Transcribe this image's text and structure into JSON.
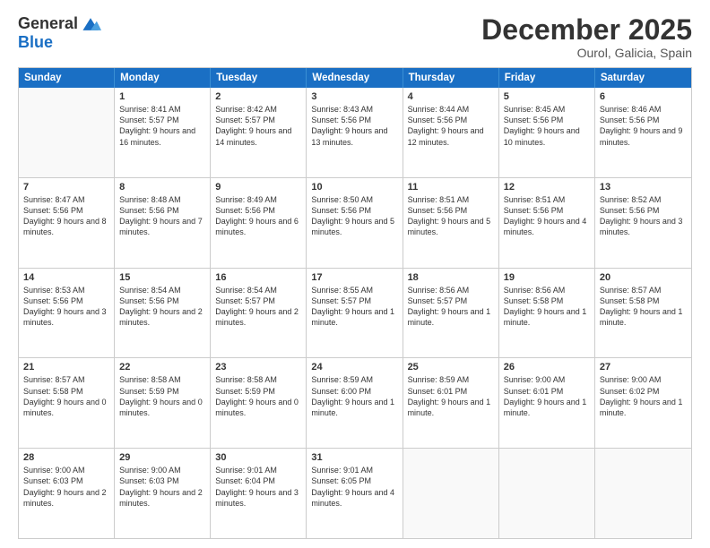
{
  "logo": {
    "general": "General",
    "blue": "Blue"
  },
  "header": {
    "month": "December 2025",
    "location": "Ourol, Galicia, Spain"
  },
  "weekdays": [
    "Sunday",
    "Monday",
    "Tuesday",
    "Wednesday",
    "Thursday",
    "Friday",
    "Saturday"
  ],
  "weeks": [
    [
      {
        "day": "",
        "empty": true
      },
      {
        "day": "1",
        "sunrise": "Sunrise: 8:41 AM",
        "sunset": "Sunset: 5:57 PM",
        "daylight": "Daylight: 9 hours and 16 minutes."
      },
      {
        "day": "2",
        "sunrise": "Sunrise: 8:42 AM",
        "sunset": "Sunset: 5:57 PM",
        "daylight": "Daylight: 9 hours and 14 minutes."
      },
      {
        "day": "3",
        "sunrise": "Sunrise: 8:43 AM",
        "sunset": "Sunset: 5:56 PM",
        "daylight": "Daylight: 9 hours and 13 minutes."
      },
      {
        "day": "4",
        "sunrise": "Sunrise: 8:44 AM",
        "sunset": "Sunset: 5:56 PM",
        "daylight": "Daylight: 9 hours and 12 minutes."
      },
      {
        "day": "5",
        "sunrise": "Sunrise: 8:45 AM",
        "sunset": "Sunset: 5:56 PM",
        "daylight": "Daylight: 9 hours and 10 minutes."
      },
      {
        "day": "6",
        "sunrise": "Sunrise: 8:46 AM",
        "sunset": "Sunset: 5:56 PM",
        "daylight": "Daylight: 9 hours and 9 minutes."
      }
    ],
    [
      {
        "day": "7",
        "sunrise": "Sunrise: 8:47 AM",
        "sunset": "Sunset: 5:56 PM",
        "daylight": "Daylight: 9 hours and 8 minutes."
      },
      {
        "day": "8",
        "sunrise": "Sunrise: 8:48 AM",
        "sunset": "Sunset: 5:56 PM",
        "daylight": "Daylight: 9 hours and 7 minutes."
      },
      {
        "day": "9",
        "sunrise": "Sunrise: 8:49 AM",
        "sunset": "Sunset: 5:56 PM",
        "daylight": "Daylight: 9 hours and 6 minutes."
      },
      {
        "day": "10",
        "sunrise": "Sunrise: 8:50 AM",
        "sunset": "Sunset: 5:56 PM",
        "daylight": "Daylight: 9 hours and 5 minutes."
      },
      {
        "day": "11",
        "sunrise": "Sunrise: 8:51 AM",
        "sunset": "Sunset: 5:56 PM",
        "daylight": "Daylight: 9 hours and 5 minutes."
      },
      {
        "day": "12",
        "sunrise": "Sunrise: 8:51 AM",
        "sunset": "Sunset: 5:56 PM",
        "daylight": "Daylight: 9 hours and 4 minutes."
      },
      {
        "day": "13",
        "sunrise": "Sunrise: 8:52 AM",
        "sunset": "Sunset: 5:56 PM",
        "daylight": "Daylight: 9 hours and 3 minutes."
      }
    ],
    [
      {
        "day": "14",
        "sunrise": "Sunrise: 8:53 AM",
        "sunset": "Sunset: 5:56 PM",
        "daylight": "Daylight: 9 hours and 3 minutes."
      },
      {
        "day": "15",
        "sunrise": "Sunrise: 8:54 AM",
        "sunset": "Sunset: 5:56 PM",
        "daylight": "Daylight: 9 hours and 2 minutes."
      },
      {
        "day": "16",
        "sunrise": "Sunrise: 8:54 AM",
        "sunset": "Sunset: 5:57 PM",
        "daylight": "Daylight: 9 hours and 2 minutes."
      },
      {
        "day": "17",
        "sunrise": "Sunrise: 8:55 AM",
        "sunset": "Sunset: 5:57 PM",
        "daylight": "Daylight: 9 hours and 1 minute."
      },
      {
        "day": "18",
        "sunrise": "Sunrise: 8:56 AM",
        "sunset": "Sunset: 5:57 PM",
        "daylight": "Daylight: 9 hours and 1 minute."
      },
      {
        "day": "19",
        "sunrise": "Sunrise: 8:56 AM",
        "sunset": "Sunset: 5:58 PM",
        "daylight": "Daylight: 9 hours and 1 minute."
      },
      {
        "day": "20",
        "sunrise": "Sunrise: 8:57 AM",
        "sunset": "Sunset: 5:58 PM",
        "daylight": "Daylight: 9 hours and 1 minute."
      }
    ],
    [
      {
        "day": "21",
        "sunrise": "Sunrise: 8:57 AM",
        "sunset": "Sunset: 5:58 PM",
        "daylight": "Daylight: 9 hours and 0 minutes."
      },
      {
        "day": "22",
        "sunrise": "Sunrise: 8:58 AM",
        "sunset": "Sunset: 5:59 PM",
        "daylight": "Daylight: 9 hours and 0 minutes."
      },
      {
        "day": "23",
        "sunrise": "Sunrise: 8:58 AM",
        "sunset": "Sunset: 5:59 PM",
        "daylight": "Daylight: 9 hours and 0 minutes."
      },
      {
        "day": "24",
        "sunrise": "Sunrise: 8:59 AM",
        "sunset": "Sunset: 6:00 PM",
        "daylight": "Daylight: 9 hours and 1 minute."
      },
      {
        "day": "25",
        "sunrise": "Sunrise: 8:59 AM",
        "sunset": "Sunset: 6:01 PM",
        "daylight": "Daylight: 9 hours and 1 minute."
      },
      {
        "day": "26",
        "sunrise": "Sunrise: 9:00 AM",
        "sunset": "Sunset: 6:01 PM",
        "daylight": "Daylight: 9 hours and 1 minute."
      },
      {
        "day": "27",
        "sunrise": "Sunrise: 9:00 AM",
        "sunset": "Sunset: 6:02 PM",
        "daylight": "Daylight: 9 hours and 1 minute."
      }
    ],
    [
      {
        "day": "28",
        "sunrise": "Sunrise: 9:00 AM",
        "sunset": "Sunset: 6:03 PM",
        "daylight": "Daylight: 9 hours and 2 minutes."
      },
      {
        "day": "29",
        "sunrise": "Sunrise: 9:00 AM",
        "sunset": "Sunset: 6:03 PM",
        "daylight": "Daylight: 9 hours and 2 minutes."
      },
      {
        "day": "30",
        "sunrise": "Sunrise: 9:01 AM",
        "sunset": "Sunset: 6:04 PM",
        "daylight": "Daylight: 9 hours and 3 minutes."
      },
      {
        "day": "31",
        "sunrise": "Sunrise: 9:01 AM",
        "sunset": "Sunset: 6:05 PM",
        "daylight": "Daylight: 9 hours and 4 minutes."
      },
      {
        "day": "",
        "empty": true
      },
      {
        "day": "",
        "empty": true
      },
      {
        "day": "",
        "empty": true
      }
    ]
  ]
}
